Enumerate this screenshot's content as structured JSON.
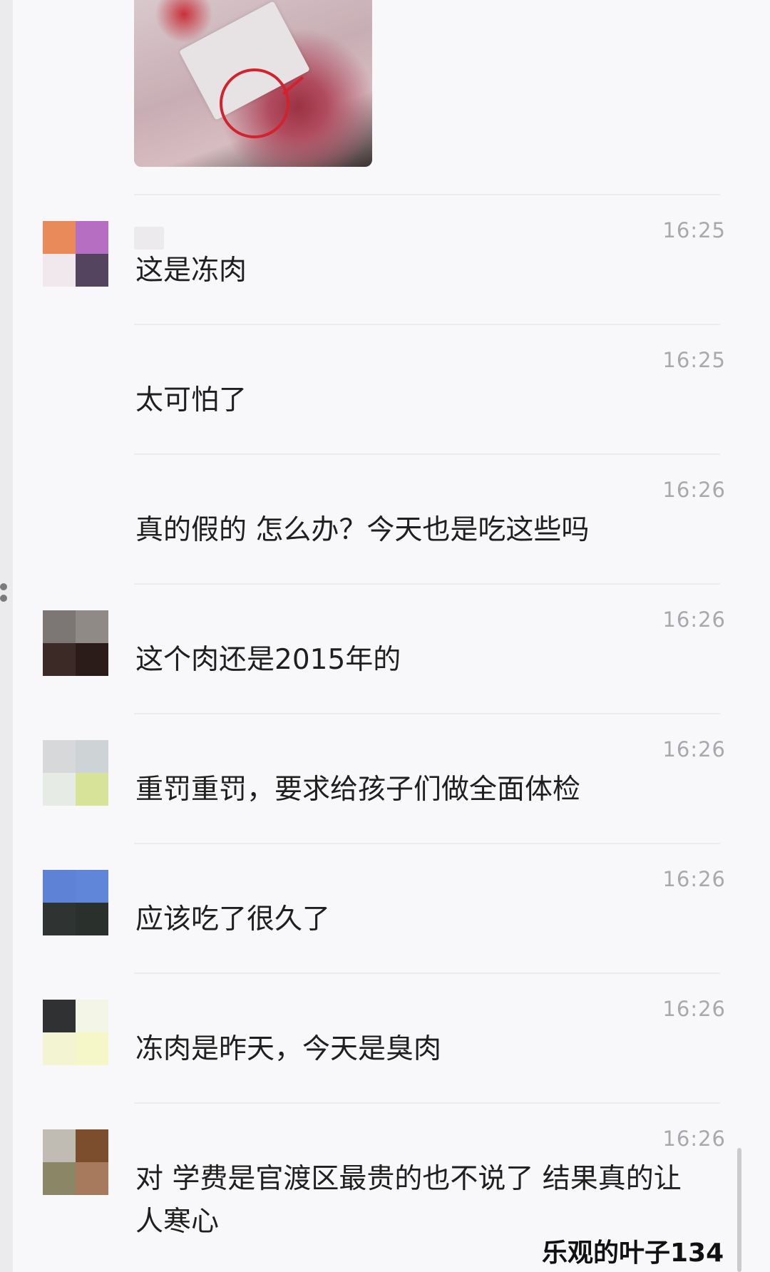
{
  "messages": [
    {
      "time": "16:25",
      "text": "这是冻肉",
      "avatar": [
        "#e88a5a",
        "#b66ec2",
        "#f1e8ee",
        "#55445f"
      ]
    },
    {
      "time": "16:25",
      "text": "太可怕了",
      "avatar": null
    },
    {
      "time": "16:26",
      "text": "真的假的  怎么办？今天也是吃这些吗",
      "avatar": null
    },
    {
      "time": "16:26",
      "text": "这个肉还是2015年的",
      "avatar": [
        "#7c7774",
        "#8f8a86",
        "#3b2a26",
        "#2b1c1a"
      ]
    },
    {
      "time": "16:26",
      "text": "重罚重罚，要求给孩子们做全面体检",
      "avatar": [
        "#d6d8da",
        "#ced4d6",
        "#e7ebe6",
        "#d8e39a"
      ]
    },
    {
      "time": "16:26",
      "text": "应该吃了很久了",
      "avatar": [
        "#5e83d6",
        "#5f86d8",
        "#2f3432",
        "#2a302c"
      ]
    },
    {
      "time": "16:26",
      "text": "冻肉是昨天，今天是臭肉",
      "avatar": [
        "#2f3132",
        "#f3f6e6",
        "#f2f4d2",
        "#f5f7c8"
      ]
    },
    {
      "time": "16:26",
      "text": "对  学费是官渡区最贵的也不说了  结果真的让人寒心",
      "avatar": [
        "#c0bcb4",
        "#7d4e2e",
        "#8b8766",
        "#a77a5e"
      ]
    }
  ],
  "watermark": "乐观的叶子134",
  "colors": {
    "background": "#f8f7f9",
    "time": "#a9a8ad",
    "text": "#1f1f1f"
  }
}
